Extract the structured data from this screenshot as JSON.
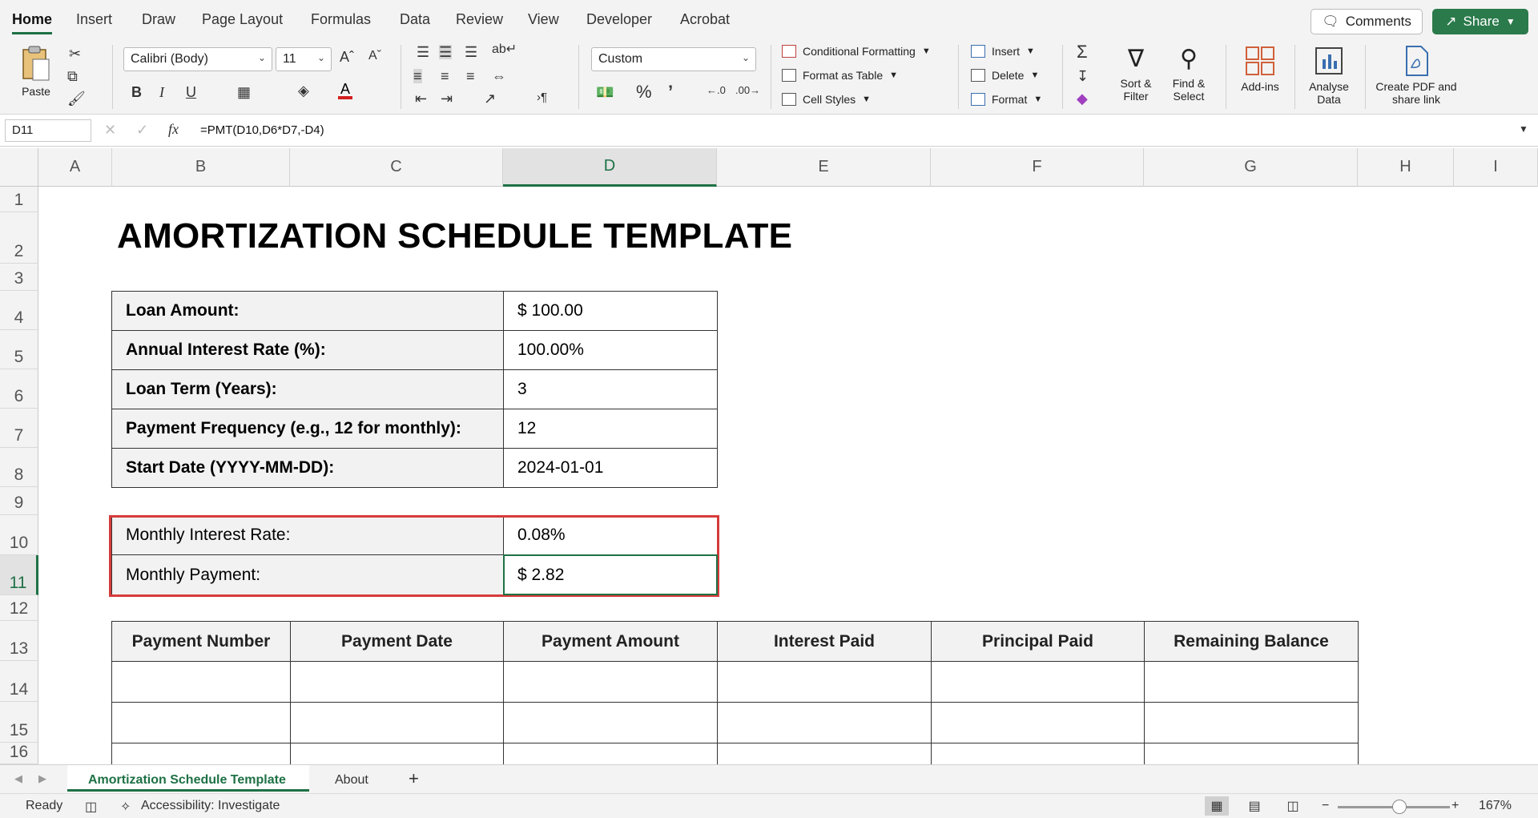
{
  "ribbon_tabs": [
    "Home",
    "Insert",
    "Draw",
    "Page Layout",
    "Formulas",
    "Data",
    "Review",
    "View",
    "Developer",
    "Acrobat"
  ],
  "header_buttons": {
    "comments": "Comments",
    "share": "Share"
  },
  "ribbon": {
    "paste": "Paste",
    "font_name": "Calibri (Body)",
    "font_size": "11",
    "number_format": "Custom",
    "conditional_formatting": "Conditional Formatting",
    "format_as_table": "Format as Table",
    "cell_styles": "Cell Styles",
    "insert": "Insert",
    "delete": "Delete",
    "format": "Format",
    "sort_filter": "Sort & Filter",
    "find_select": "Find & Select",
    "add_ins": "Add-ins",
    "analyse_data": "Analyse Data",
    "create_pdf": "Create PDF and share link",
    "bold": "B",
    "italic": "I",
    "underline": "U"
  },
  "formula_bar": {
    "cell_ref": "D11",
    "formula": "=PMT(D10,D6*D7,-D4)"
  },
  "columns": [
    "A",
    "B",
    "C",
    "D",
    "E",
    "F",
    "G",
    "H",
    "I"
  ],
  "rows": [
    "1",
    "2",
    "3",
    "4",
    "5",
    "6",
    "7",
    "8",
    "9",
    "10",
    "11",
    "12",
    "13",
    "14",
    "15",
    "16"
  ],
  "sheet": {
    "title": "AMORTIZATION SCHEDULE TEMPLATE",
    "inputs": [
      {
        "label": "Loan Amount:",
        "value": "$ 100.00"
      },
      {
        "label": "Annual Interest Rate (%):",
        "value": "100.00%"
      },
      {
        "label": "Loan Term (Years):",
        "value": "3"
      },
      {
        "label": "Payment Frequency (e.g., 12 for monthly):",
        "value": "12"
      },
      {
        "label": "Start Date (YYYY-MM-DD):",
        "value": "2024-01-01"
      }
    ],
    "computed": [
      {
        "label": "Monthly Interest Rate:",
        "value": "0.08%"
      },
      {
        "label": "Monthly Payment:",
        "value": "$ 2.82"
      }
    ],
    "schedule_headers": [
      "Payment Number",
      "Payment Date",
      "Payment Amount",
      "Interest Paid",
      "Principal Paid",
      "Remaining Balance"
    ]
  },
  "sheet_tabs": [
    "Amortization Schedule Template",
    "About"
  ],
  "status": {
    "ready": "Ready",
    "accessibility": "Accessibility: Investigate",
    "zoom": "167%"
  },
  "colors": {
    "accent": "#1e7145",
    "highlight": "#d63b3b",
    "share": "#2b7a4b"
  }
}
